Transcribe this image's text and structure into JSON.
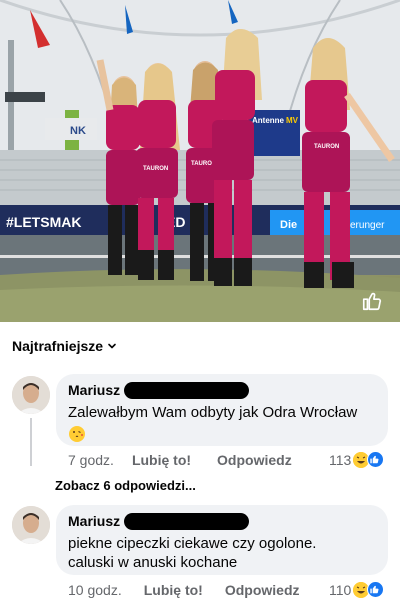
{
  "sort": {
    "label": "Najtrafniejsze",
    "icon": "chevron-down-icon"
  },
  "comments": [
    {
      "author": "Mariusz",
      "text_lines": [
        "Zalewałbym Wam odbyty jak Odra Wrocław"
      ],
      "emoji": "kissing-face-emoji",
      "time": "7 godz.",
      "like_label": "Lubię to!",
      "reply_label": "Odpowiedz",
      "reaction_count": "113",
      "reactions": [
        "haha",
        "like"
      ]
    },
    {
      "author": "Mariusz",
      "text_lines": [
        "piekne cipeczki ciekawe czy ogolone.",
        "caluski w anuski kochane"
      ],
      "time": "10 godz.",
      "like_label": "Lubię to!",
      "reply_label": "Odpowiedz",
      "reaction_count": "110",
      "reactions": [
        "haha",
        "like"
      ]
    }
  ],
  "see_replies": "Zobacz 6 odpowiedzi...",
  "photo": {
    "banner_left": "#LETSMAK",
    "banner_mid": "ED",
    "banner_right": "Die",
    "banner_right2": "erunger",
    "sign_top": "Antenne",
    "sign_top2": "MV",
    "sign_small": "NK",
    "sponsor": "TAURON",
    "outfit_color": "#c2185b"
  }
}
